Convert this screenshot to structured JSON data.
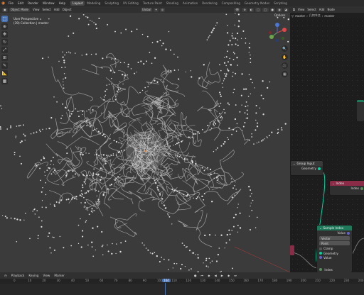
{
  "menubar": {
    "menus": [
      "File",
      "Edit",
      "Render",
      "Window",
      "Help"
    ],
    "workspaces": [
      "Layout",
      "Modeling",
      "Sculpting",
      "UV Editing",
      "Texture Paint",
      "Shading",
      "Animation",
      "Rendering",
      "Compositing",
      "Geometry Nodes",
      "Scripting"
    ],
    "active_workspace": "Layout"
  },
  "viewport": {
    "mode": "Object Mode",
    "menus": [
      "View",
      "Select",
      "Add",
      "Object"
    ],
    "orientation": "Global",
    "options_label": "Options",
    "info_line1": "User Perspective",
    "info_line2": "(39) Collection | master"
  },
  "node_editor": {
    "menus": [
      "View",
      "Select",
      "Add",
      "Node"
    ],
    "object_name": "master",
    "breadcrumb_object": "master",
    "breadcrumb_modifier": "几何节点",
    "breadcrumb_tree": "master",
    "nodes": {
      "group_input": {
        "title": "Group Input",
        "out_geometry": "Geometry"
      },
      "index": {
        "title": "Index",
        "out_index": "Index"
      },
      "sample_index": {
        "title": "Sample Index",
        "out_value": "Value",
        "type": "Vector",
        "domain": "Point",
        "clamp": "Clamp",
        "in_geometry": "Geometry",
        "in_value": "Value",
        "in_index": "Index"
      }
    }
  },
  "timeline": {
    "menus": [
      "Playback",
      "Keying",
      "View",
      "Marker"
    ],
    "current_frame": "104",
    "ticks": [
      "0",
      "10",
      "20",
      "30",
      "40",
      "50",
      "60",
      "70",
      "80",
      "90",
      "100",
      "110",
      "120",
      "130",
      "140",
      "150",
      "160",
      "170",
      "180",
      "190",
      "200",
      "210",
      "220",
      "230",
      "240",
      "250"
    ]
  },
  "colors": {
    "accent": "#4772b3",
    "geometry_socket": "#00d6a3",
    "vector_socket": "#6363c7",
    "int_socket": "#598c5c",
    "index_header": "#8a2c48",
    "sample_header": "#1f7a5c"
  }
}
